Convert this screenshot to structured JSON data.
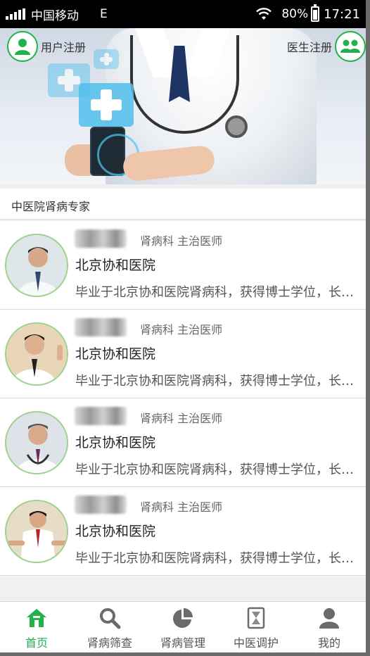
{
  "status_bar": {
    "carrier": "中国移动",
    "network": "E",
    "battery": "80%",
    "time": "17:21"
  },
  "banner": {
    "user_register": "用户注册",
    "doctor_register": "医生注册"
  },
  "section": {
    "title": "中医院肾病专家"
  },
  "doctors": [
    {
      "dept": "肾病科 主治医师",
      "hospital": "北京协和医院",
      "desc": "毕业于北京协和医院肾病科，获得博士学位，长期从事肾病临床工作"
    },
    {
      "dept": "肾病科 主治医师",
      "hospital": "北京协和医院",
      "desc": "毕业于北京协和医院肾病科，获得博士学位，长期从事肾病临床工作"
    },
    {
      "dept": "肾病科 主治医师",
      "hospital": "北京协和医院",
      "desc": "毕业于北京协和医院肾病科，获得博士学位，长期从事肾病临床工作"
    },
    {
      "dept": "肾病科 主治医师",
      "hospital": "北京协和医院",
      "desc": "毕业于北京协和医院肾病科，获得博士学位，长期从事肾病临床工作"
    }
  ],
  "tabs": [
    {
      "label": "首页",
      "icon": "home-icon"
    },
    {
      "label": "肾病筛查",
      "icon": "search-icon"
    },
    {
      "label": "肾病管理",
      "icon": "pie-chart-icon"
    },
    {
      "label": "中医调护",
      "icon": "hourglass-icon"
    },
    {
      "label": "我的",
      "icon": "person-icon"
    }
  ],
  "colors": {
    "accent": "#22b24c",
    "status_bar": "#000000",
    "tie": "#1e3564"
  }
}
